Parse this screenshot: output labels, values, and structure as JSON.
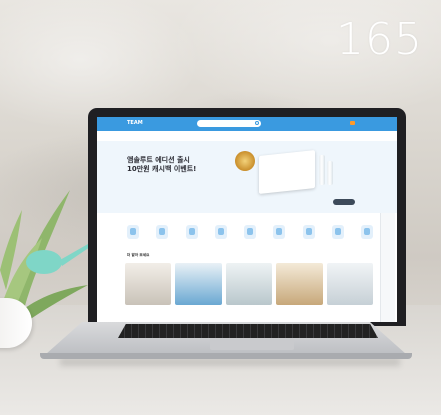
{
  "overlay": {
    "page_number": "165"
  },
  "website": {
    "logo": "TEAM",
    "hero": {
      "title_line1": "앰솔루트 에디션 출시",
      "title_line2": "10만원 캐시백 이벤트!"
    },
    "section_title": "더 알아 보세요",
    "colors": {
      "header": "#3a9ae0",
      "hero_bg": "#eff6fc"
    }
  },
  "scene": {
    "device": "laptop",
    "plant": "aloe-vera",
    "surface": "marble-desk"
  }
}
